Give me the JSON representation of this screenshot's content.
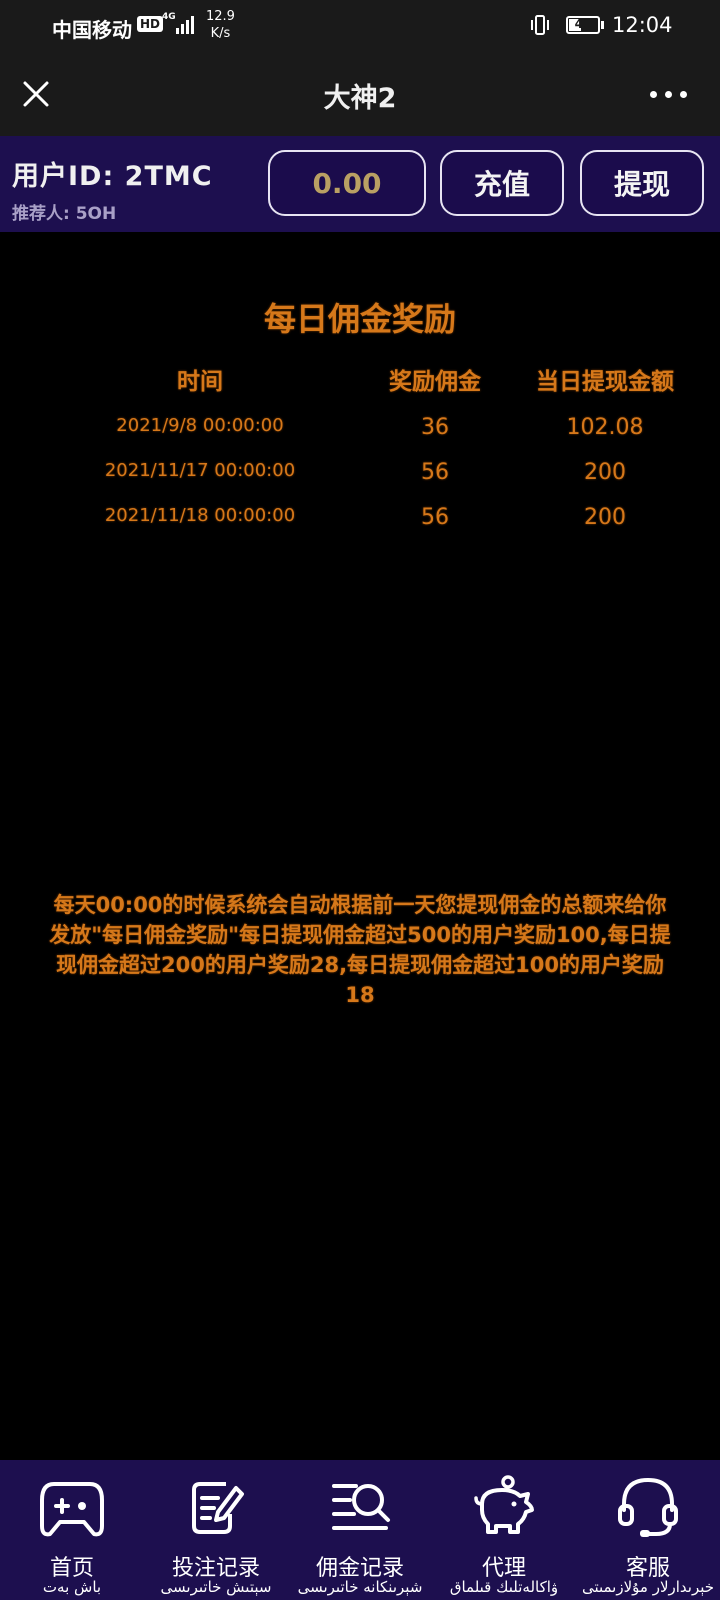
{
  "status_bar": {
    "carrier": "中国移动",
    "hd": "HD",
    "network": "4G",
    "speed_value": "12.9",
    "speed_unit": "K/s",
    "battery": "41",
    "time": "12:04"
  },
  "titlebar": {
    "title": "大神2",
    "close_icon": "close-icon",
    "more_icon": "more-icon"
  },
  "user": {
    "id_label": "用户ID: 2TMC",
    "referrer_label": "推荐人: 5OH",
    "balance": "0.00",
    "recharge_label": "充值",
    "withdraw_label": "提现"
  },
  "reward": {
    "title": "每日佣金奖励",
    "headers": {
      "time": "时间",
      "commission": "奖励佣金",
      "amount": "当日提现金额"
    },
    "rows": [
      {
        "time": "2021/9/8 00:00:00",
        "commission": "36",
        "amount": "102.08"
      },
      {
        "time": "2021/11/17 00:00:00",
        "commission": "56",
        "amount": "200"
      },
      {
        "time": "2021/11/18 00:00:00",
        "commission": "56",
        "amount": "200"
      }
    ],
    "note": "每天00:00的时候系统会自动根据前一天您提现佣金的总额来给你发放\"每日佣金奖励\"每日提现佣金超过500的用户奖励100,每日提现佣金超过200的用户奖励28,每日提现佣金超过100的用户奖励18"
  },
  "nav": [
    {
      "label": "首页",
      "sub": "باش بەت",
      "icon": "gamepad-icon"
    },
    {
      "label": "投注记录",
      "sub": "سېتىش خاتىرىسى",
      "icon": "edit-note-icon"
    },
    {
      "label": "佣金记录",
      "sub": "شېرىنكانە خاتىرىسى",
      "icon": "search-list-icon"
    },
    {
      "label": "代理",
      "sub": "ۋاكالەتلىك قىلماق",
      "icon": "piggy-bank-icon"
    },
    {
      "label": "客服",
      "sub": "خېرىدارلار مۇلازىمىتى",
      "icon": "headset-icon"
    }
  ],
  "colors": {
    "header_bg": "#1a1a1a",
    "brand_purple": "#1d0f4f",
    "accent_orange": "#d6781a",
    "balance_gold": "#b9a063"
  }
}
